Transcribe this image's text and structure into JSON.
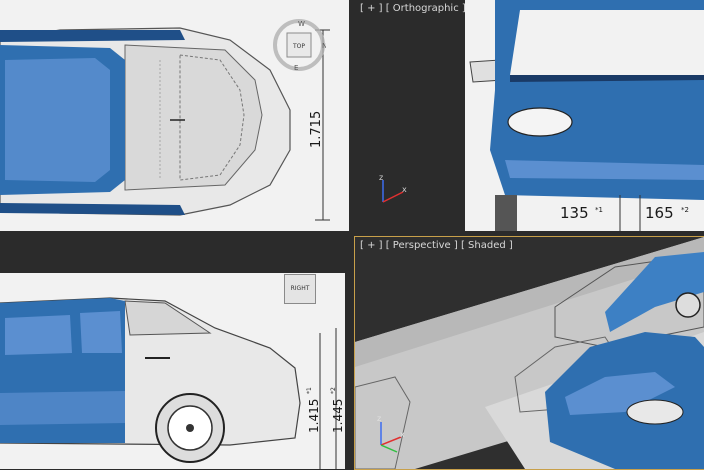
{
  "viewports": {
    "top": {
      "viewcube_label": "TOP",
      "compass": {
        "n": "N",
        "e": "E",
        "w": "W"
      },
      "dimension": "1.715"
    },
    "front": {
      "label": "[ + ] [ Orthographic ] [ Shaded ]",
      "dim_left": "135",
      "dim_left_sup": "*1",
      "dim_right": "165",
      "dim_right_sup": "*2",
      "axis_z": "z",
      "axis_x": "x"
    },
    "right": {
      "viewcube_label": "RIGHT",
      "dim_a": "1.415",
      "dim_a_sup": "*1",
      "dim_b": "1.445",
      "dim_b_sup": "*2"
    },
    "perspective": {
      "label": "[ + ] [ Perspective ] [ Shaded ]",
      "axis_z": "z",
      "axis_x": "x"
    }
  },
  "colors": {
    "car_blue": "#2f6fb0",
    "active_border": "#c8a04a"
  }
}
